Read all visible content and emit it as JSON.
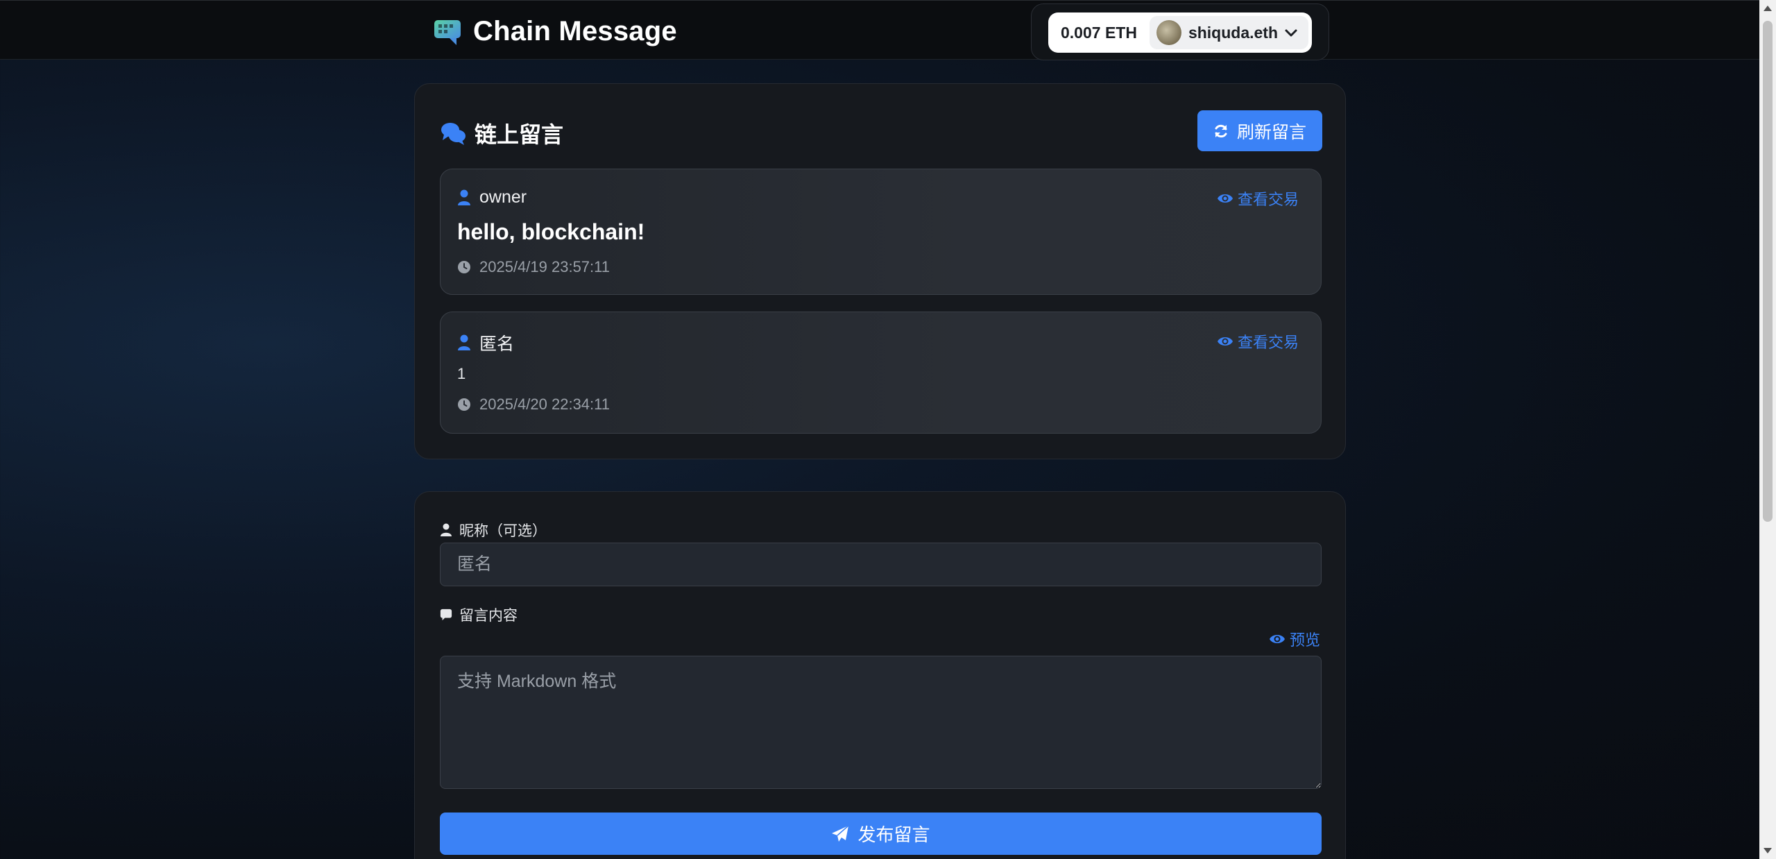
{
  "header": {
    "brand_title": "Chain Message",
    "logo_icon": "chat-bubbles-icon",
    "wallet": {
      "balance": "0.007 ETH",
      "account": "shiquda.eth"
    }
  },
  "messages_panel": {
    "title": "链上留言",
    "refresh_label": "刷新留言",
    "view_tx_label": "查看交易",
    "items": [
      {
        "author": "owner",
        "content": "hello, blockchain!",
        "time": "2025/4/19 23:57:11"
      },
      {
        "author": "匿名",
        "content": "1",
        "time": "2025/4/20 22:34:11"
      }
    ]
  },
  "form": {
    "nickname_label": "昵称（可选）",
    "nickname_placeholder": "匿名",
    "content_label": "留言内容",
    "preview_label": "预览",
    "content_placeholder": "支持 Markdown 格式",
    "submit_label": "发布留言"
  },
  "colors": {
    "accent": "#3b82f6",
    "card_bg": "#16191e",
    "page_bg": "#0a0f17"
  }
}
